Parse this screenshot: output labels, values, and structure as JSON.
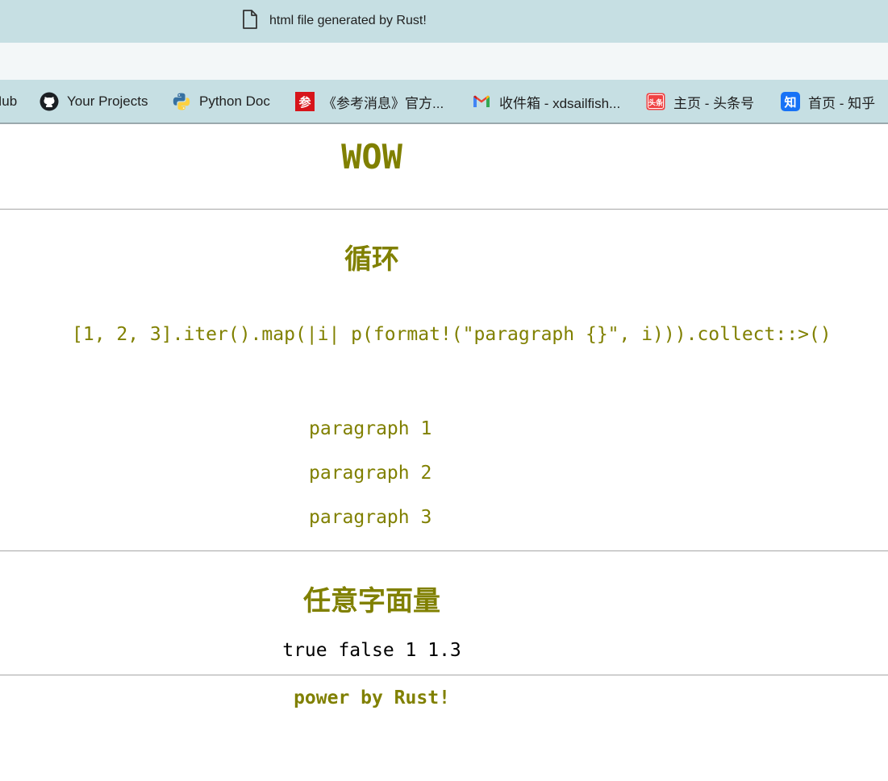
{
  "browser": {
    "tab_title": "html file generated by Rust!",
    "bookmarks": [
      {
        "label": "Hub",
        "icon": "github-icon"
      },
      {
        "label": "Your Projects",
        "icon": "github-icon"
      },
      {
        "label": "Python Doc",
        "icon": "python-icon"
      },
      {
        "label": "《参考消息》官方...",
        "icon": "cankaoxiaoxi-icon"
      },
      {
        "label": "收件箱 - xdsailfish...",
        "icon": "gmail-icon"
      },
      {
        "label": "主页 - 头条号",
        "icon": "toutiao-icon"
      },
      {
        "label": "首页 - 知乎",
        "icon": "zhihu-icon"
      }
    ]
  },
  "page": {
    "title": "WOW",
    "loop_heading": "循环",
    "loop_code": "[1, 2, 3].iter().map(|i| p(format!(\"paragraph {}\", i))).collect::>()",
    "paragraphs": [
      "paragraph 1",
      "paragraph 2",
      "paragraph 3"
    ],
    "literal_heading": "任意字面量",
    "literals": "true false 1 1.3",
    "footer": "power by Rust!"
  },
  "colors": {
    "accent": "#808000",
    "chrome": "#c6dfe3"
  }
}
